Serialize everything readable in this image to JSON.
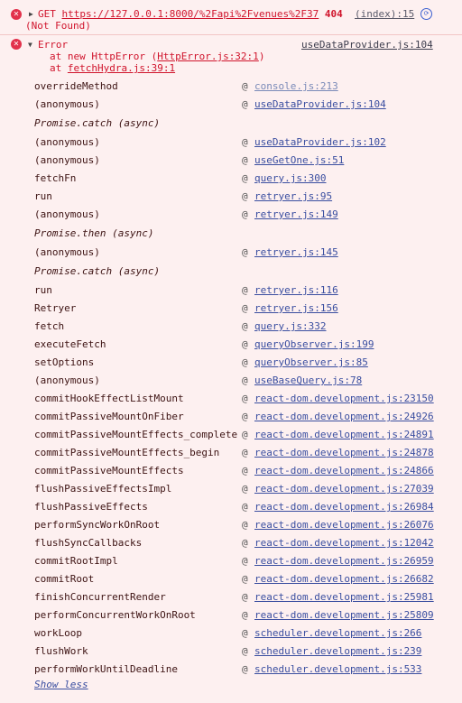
{
  "request": {
    "method": "GET",
    "url": "https://127.0.0.1:8000/%2Fapi%2Fvenues%2F37",
    "status": "404",
    "status_text": "(Not Found)",
    "source": "(index):15"
  },
  "error": {
    "title": "Error",
    "source": "useDataProvider.js:104",
    "line1_prefix": "at new HttpError (",
    "line1_link": "HttpError.js:32:1",
    "line1_suffix": ")",
    "line2_prefix": "at ",
    "line2_link": "fetchHydra.js:39:1"
  },
  "stack": [
    {
      "fn": "overrideMethod",
      "loc": "console.js:213",
      "at": "@",
      "dim": true
    },
    {
      "fn": "(anonymous)",
      "loc": "useDataProvider.js:104",
      "at": "@"
    },
    {
      "fn": "Promise.catch (async)",
      "async": true
    },
    {
      "fn": "(anonymous)",
      "loc": "useDataProvider.js:102",
      "at": "@"
    },
    {
      "fn": "(anonymous)",
      "loc": "useGetOne.js:51",
      "at": "@"
    },
    {
      "fn": "fetchFn",
      "loc": "query.js:300",
      "at": "@"
    },
    {
      "fn": "run",
      "loc": "retryer.js:95",
      "at": "@"
    },
    {
      "fn": "(anonymous)",
      "loc": "retryer.js:149",
      "at": "@"
    },
    {
      "fn": "Promise.then (async)",
      "async": true
    },
    {
      "fn": "(anonymous)",
      "loc": "retryer.js:145",
      "at": "@"
    },
    {
      "fn": "Promise.catch (async)",
      "async": true
    },
    {
      "fn": "run",
      "loc": "retryer.js:116",
      "at": "@"
    },
    {
      "fn": "Retryer",
      "loc": "retryer.js:156",
      "at": "@"
    },
    {
      "fn": "fetch",
      "loc": "query.js:332",
      "at": "@"
    },
    {
      "fn": "executeFetch",
      "loc": "queryObserver.js:199",
      "at": "@"
    },
    {
      "fn": "setOptions",
      "loc": "queryObserver.js:85",
      "at": "@"
    },
    {
      "fn": "(anonymous)",
      "loc": "useBaseQuery.js:78",
      "at": "@"
    },
    {
      "fn": "commitHookEffectListMount",
      "loc": "react-dom.development.js:23150",
      "at": "@"
    },
    {
      "fn": "commitPassiveMountOnFiber",
      "loc": "react-dom.development.js:24926",
      "at": "@"
    },
    {
      "fn": "commitPassiveMountEffects_complete",
      "loc": "react-dom.development.js:24891",
      "at": "@"
    },
    {
      "fn": "commitPassiveMountEffects_begin",
      "loc": "react-dom.development.js:24878",
      "at": "@"
    },
    {
      "fn": "commitPassiveMountEffects",
      "loc": "react-dom.development.js:24866",
      "at": "@"
    },
    {
      "fn": "flushPassiveEffectsImpl",
      "loc": "react-dom.development.js:27039",
      "at": "@"
    },
    {
      "fn": "flushPassiveEffects",
      "loc": "react-dom.development.js:26984",
      "at": "@"
    },
    {
      "fn": "performSyncWorkOnRoot",
      "loc": "react-dom.development.js:26076",
      "at": "@"
    },
    {
      "fn": "flushSyncCallbacks",
      "loc": "react-dom.development.js:12042",
      "at": "@"
    },
    {
      "fn": "commitRootImpl",
      "loc": "react-dom.development.js:26959",
      "at": "@"
    },
    {
      "fn": "commitRoot",
      "loc": "react-dom.development.js:26682",
      "at": "@"
    },
    {
      "fn": "finishConcurrentRender",
      "loc": "react-dom.development.js:25981",
      "at": "@"
    },
    {
      "fn": "performConcurrentWorkOnRoot",
      "loc": "react-dom.development.js:25809",
      "at": "@"
    },
    {
      "fn": "workLoop",
      "loc": "scheduler.development.js:266",
      "at": "@"
    },
    {
      "fn": "flushWork",
      "loc": "scheduler.development.js:239",
      "at": "@"
    },
    {
      "fn": "performWorkUntilDeadline",
      "loc": "scheduler.development.js:533",
      "at": "@"
    }
  ],
  "show_less": "Show less",
  "colors": {
    "background": "#fdf0f0",
    "error_red": "#d0142c",
    "link_blue": "#3a4ea0",
    "icon_red": "#e2314b"
  }
}
